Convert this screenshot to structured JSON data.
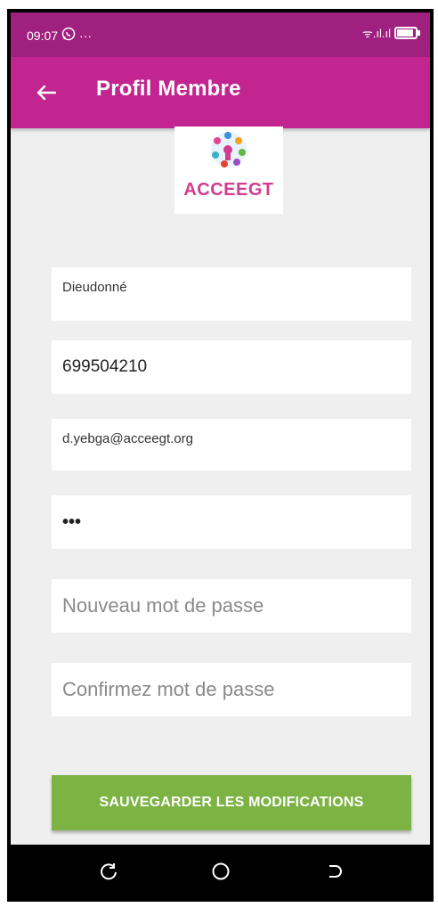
{
  "status_bar": {
    "time": "09:07",
    "whatsapp_icon": "whatsapp-icon",
    "more_dots": "···",
    "signal_text": "ᯤ.ıl.ıl"
  },
  "app_bar": {
    "title": "Profil Membre",
    "back_icon": "arrow-back-icon"
  },
  "logo": {
    "text": "ACCEEGT"
  },
  "form": {
    "first_name_value": "Dieudonné",
    "phone_value": "699504210",
    "email_value": "d.yebga@acceegt.org",
    "password_value": "•••",
    "new_password_placeholder": "Nouveau mot de passe",
    "confirm_password_placeholder": "Confirmez mot de passe",
    "save_label": "SAUVEGARDER LES MODIFICATIONS"
  },
  "colors": {
    "status_bar": "#a0207f",
    "app_bar": "#c32590",
    "save_button": "#7db343",
    "logo_text": "#d13c8f"
  },
  "nav_bar": {
    "items": [
      "recent-apps-icon",
      "home-icon",
      "back-icon"
    ]
  }
}
